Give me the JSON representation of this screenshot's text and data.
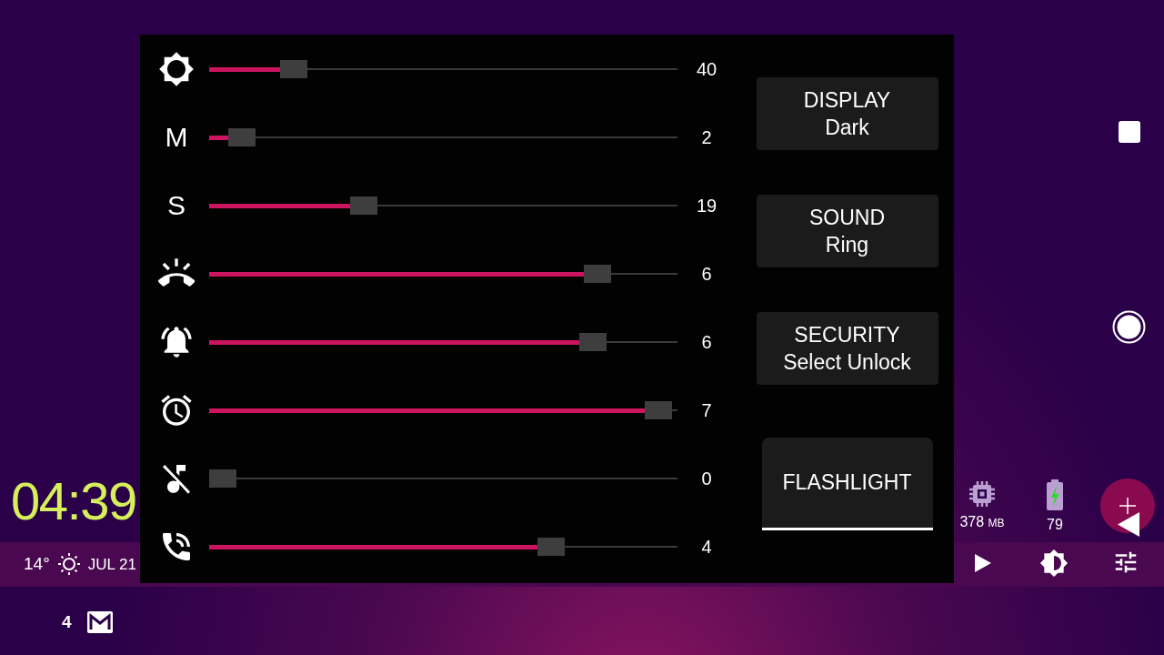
{
  "sliders": [
    {
      "kind": "brightness",
      "level": 0.18,
      "reading": "40"
    },
    {
      "kind": "letter",
      "label": "M",
      "level": 0.07,
      "reading": "2"
    },
    {
      "kind": "letter",
      "label": "S",
      "level": 0.33,
      "reading": "19"
    },
    {
      "kind": "ring",
      "level": 0.83,
      "reading": "6"
    },
    {
      "kind": "notification",
      "level": 0.82,
      "reading": "6"
    },
    {
      "kind": "alarm",
      "level": 0.96,
      "reading": "7"
    },
    {
      "kind": "mute",
      "level": 0,
      "reading": "0"
    },
    {
      "kind": "call",
      "level": 0.73,
      "reading": "4"
    }
  ],
  "mode_buttons": [
    {
      "title": "DISPLAY",
      "value": "Dark"
    },
    {
      "title": "SOUND",
      "value": "Ring"
    },
    {
      "title": "SECURITY",
      "value": "Select Unlock"
    }
  ],
  "flashlight": {
    "label": "FLASHLIGHT",
    "on": true
  },
  "clock": "04:39",
  "weather": {
    "temperature": "14°",
    "date": "JUL 21"
  },
  "memory": {
    "value": "378",
    "unit": "MB"
  },
  "battery": {
    "value": "79"
  },
  "mail": {
    "count": "4"
  }
}
